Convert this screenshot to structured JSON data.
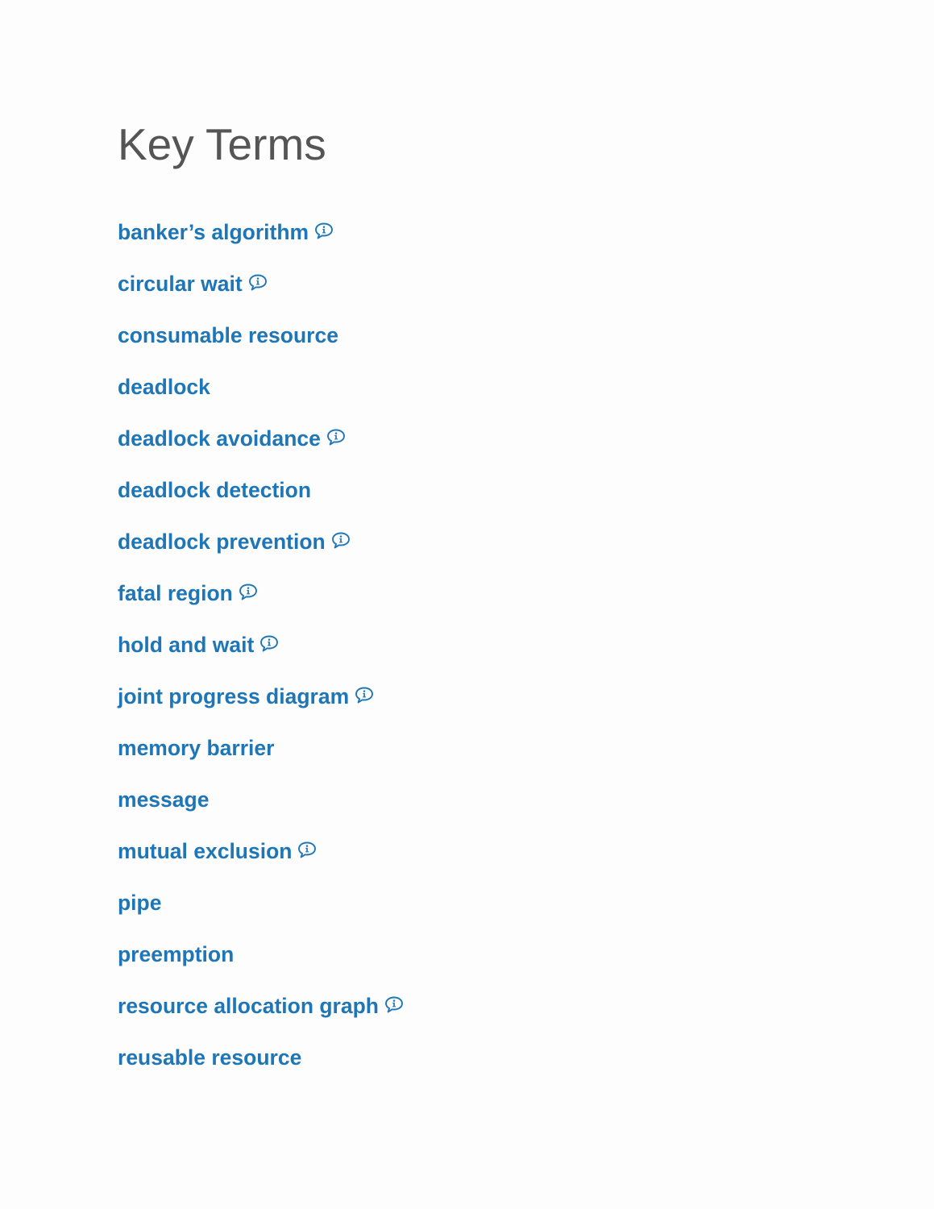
{
  "page": {
    "title": "Key Terms"
  },
  "colors": {
    "title": "#555555",
    "link": "#1f76b6",
    "icon": "#1f76b6"
  },
  "terms": [
    {
      "label": "banker’s algorithm",
      "has_info_icon": true,
      "icon": "info-speech-bubble-icon"
    },
    {
      "label": "circular wait",
      "has_info_icon": true,
      "icon": "info-speech-bubble-icon"
    },
    {
      "label": "consumable resource",
      "has_info_icon": false
    },
    {
      "label": "deadlock",
      "has_info_icon": false
    },
    {
      "label": "deadlock avoidance",
      "has_info_icon": true,
      "icon": "info-speech-bubble-icon"
    },
    {
      "label": "deadlock detection",
      "has_info_icon": false
    },
    {
      "label": "deadlock prevention",
      "has_info_icon": true,
      "icon": "info-speech-bubble-icon"
    },
    {
      "label": "fatal region",
      "has_info_icon": true,
      "icon": "info-speech-bubble-icon"
    },
    {
      "label": "hold and wait",
      "has_info_icon": true,
      "icon": "info-speech-bubble-icon"
    },
    {
      "label": "joint progress diagram",
      "has_info_icon": true,
      "icon": "info-speech-bubble-icon"
    },
    {
      "label": "memory barrier",
      "has_info_icon": false
    },
    {
      "label": "message",
      "has_info_icon": false
    },
    {
      "label": "mutual exclusion",
      "has_info_icon": true,
      "icon": "info-speech-bubble-icon"
    },
    {
      "label": "pipe",
      "has_info_icon": false
    },
    {
      "label": "preemption",
      "has_info_icon": false
    },
    {
      "label": "resource allocation graph",
      "has_info_icon": true,
      "icon": "info-speech-bubble-icon"
    },
    {
      "label": "reusable resource",
      "has_info_icon": false
    }
  ]
}
